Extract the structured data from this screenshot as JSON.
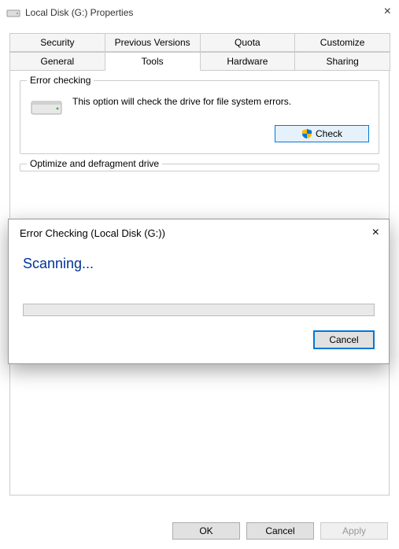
{
  "window": {
    "title": "Local Disk (G:) Properties"
  },
  "tabs": {
    "row1": [
      "Security",
      "Previous Versions",
      "Quota",
      "Customize"
    ],
    "row2": [
      "General",
      "Tools",
      "Hardware",
      "Sharing"
    ],
    "active": "Tools"
  },
  "errorChecking": {
    "groupTitle": "Error checking",
    "description": "This option will check the drive for file system errors.",
    "buttonLabel": "Check"
  },
  "defrag": {
    "groupTitle": "Optimize and defragment drive"
  },
  "modal": {
    "title": "Error Checking (Local Disk (G:))",
    "status": "Scanning...",
    "cancelLabel": "Cancel"
  },
  "dialogButtons": {
    "ok": "OK",
    "cancel": "Cancel",
    "apply": "Apply"
  }
}
